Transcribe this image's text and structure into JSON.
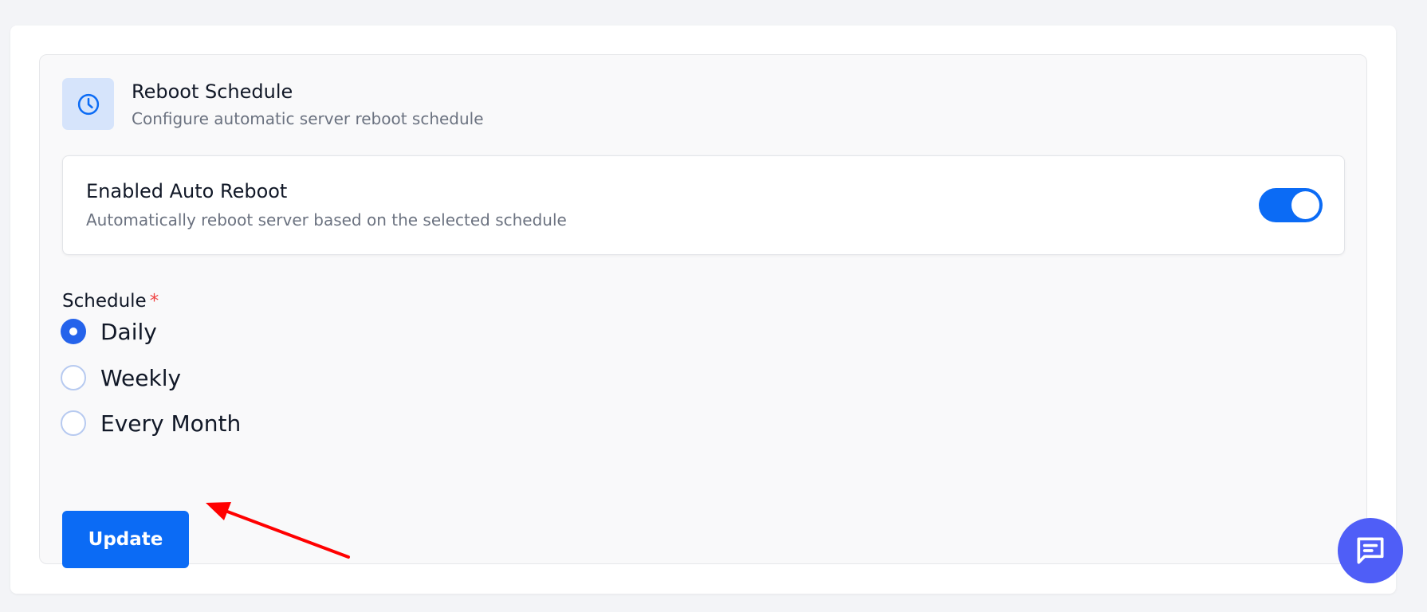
{
  "section": {
    "title": "Reboot Schedule",
    "subtitle": "Configure automatic server reboot schedule",
    "icon": "clock-icon"
  },
  "auto_reboot": {
    "title": "Enabled Auto Reboot",
    "description": "Automatically reboot server based on the selected schedule",
    "enabled": true
  },
  "schedule": {
    "label": "Schedule",
    "required_marker": "*",
    "options": [
      {
        "label": "Daily",
        "selected": true
      },
      {
        "label": "Weekly",
        "selected": false
      },
      {
        "label": "Every Month",
        "selected": false
      }
    ]
  },
  "actions": {
    "update_label": "Update"
  },
  "chat": {
    "icon": "chat-icon"
  },
  "colors": {
    "primary": "#0b6bf5",
    "radio_checked": "#2563eb",
    "required": "#ef4444",
    "chat_fab": "#4f5ef7",
    "annotation_arrow": "#ff0000"
  }
}
